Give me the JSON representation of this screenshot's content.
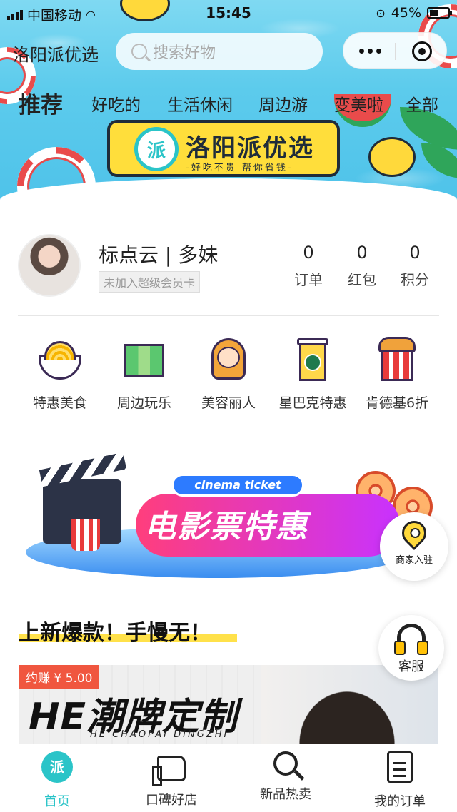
{
  "status_bar": {
    "carrier": "中国移动",
    "time": "15:45",
    "battery": "45%"
  },
  "nav": {
    "app_title": "洛阳派优选",
    "search_placeholder": "搜索好物"
  },
  "categories": [
    {
      "label": "推荐",
      "active": true
    },
    {
      "label": "好吃的"
    },
    {
      "label": "生活休闲"
    },
    {
      "label": "周边游"
    },
    {
      "label": "变美啦"
    },
    {
      "label": "全部"
    }
  ],
  "brand": {
    "logo_char": "派",
    "name": "洛阳派优选",
    "slogan": "-好吃不贵 帮你省钱-"
  },
  "profile": {
    "name": "标点云 | 多妹",
    "member_badge": "未加入超级会员卡",
    "stats": [
      {
        "value": "0",
        "label": "订单"
      },
      {
        "value": "0",
        "label": "红包"
      },
      {
        "value": "0",
        "label": "积分"
      }
    ]
  },
  "quick_links": [
    {
      "label": "特惠美食",
      "icon": "noodle-bowl-icon"
    },
    {
      "label": "周边玩乐",
      "icon": "map-icon"
    },
    {
      "label": "美容丽人",
      "icon": "woman-icon"
    },
    {
      "label": "星巴克特惠",
      "icon": "coffee-cup-icon"
    },
    {
      "label": "肯德基6折",
      "icon": "fried-chicken-icon"
    }
  ],
  "cinema_banner": {
    "tag": "cinema ticket",
    "title": "电影票特惠"
  },
  "floating": {
    "merchant": "商家入驻",
    "service": "客服"
  },
  "new_section": {
    "title": "上新爆款！手慢无！",
    "product": {
      "earn_badge": "约赚 ¥ 5.00",
      "title": "HE潮牌定制",
      "subtitle": "HE CHAOPAI DINGZHI"
    }
  },
  "tabbar": [
    {
      "label": "首页",
      "icon": "home-logo-icon",
      "active": true
    },
    {
      "label": "口碑好店",
      "icon": "thumbs-up-icon"
    },
    {
      "label": "新品热卖",
      "icon": "magnifier-icon"
    },
    {
      "label": "我的订单",
      "icon": "document-icon"
    }
  ],
  "colors": {
    "accent": "#2bc4c8",
    "pool": "#5ccbec",
    "highlight": "#ffe14a",
    "badge": "#f0563f"
  }
}
